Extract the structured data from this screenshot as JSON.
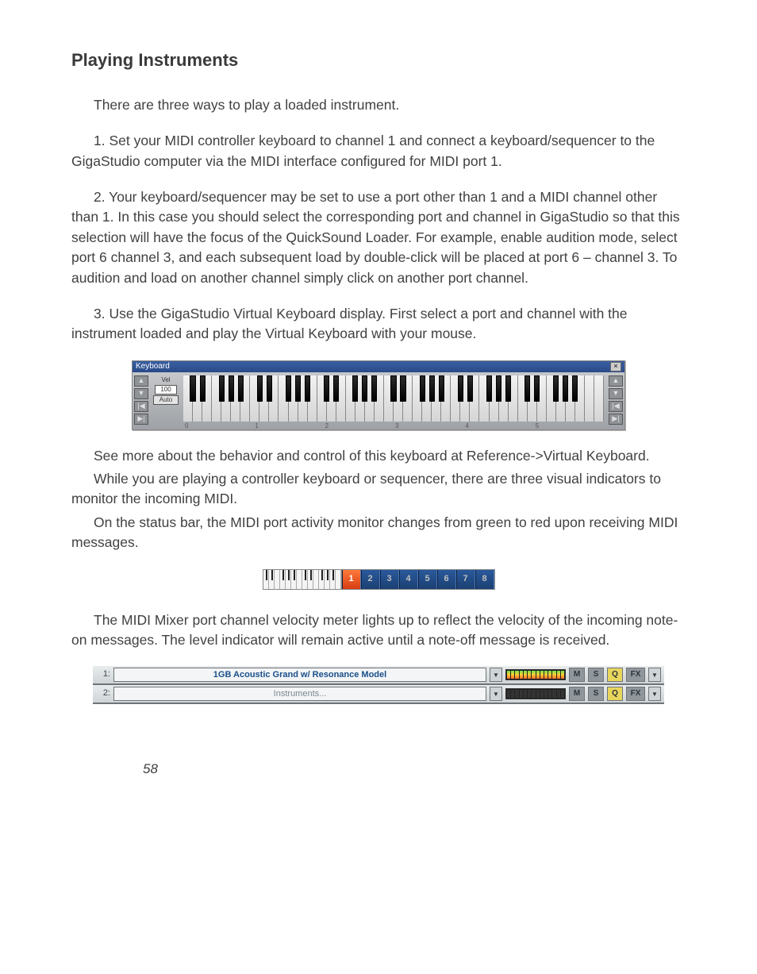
{
  "heading": "Playing Instruments",
  "p_intro": "There are three ways to play a loaded instrument.",
  "p_step1": "1. Set your MIDI controller keyboard to channel 1 and connect a keyboard/sequencer to the GigaStudio computer via the MIDI interface configured for MIDI port 1.",
  "p_step2": "2. Your keyboard/sequencer may be set to use a port other than 1 and a MIDI channel other than 1. In this case you should select the corresponding port and channel in GigaStudio so that this selection will have the focus of the QuickSound Loader. For example, enable audition mode, select port 6 channel 3, and each subsequent load by double-click will be placed at port 6 – channel 3. To audition and load on another channel simply click on another port channel.",
  "p_step3": "3. Use the GigaStudio Virtual Keyboard display. First select a port and channel with the instrument loaded and play the Virtual Keyboard with your mouse.",
  "p_after_kbd_1": "See more about the behavior and control of this keyboard at Reference->Virtual Keyboard.",
  "p_after_kbd_2": "While you are playing a controller keyboard or sequencer, there are three visual indicators to monitor the incoming MIDI.",
  "p_after_kbd_3": "On the status bar, the MIDI port activity monitor changes from green to red upon receiving MIDI messages.",
  "p_after_ports": "The MIDI Mixer port channel velocity meter lights up to reflect the velocity of the incoming note-on messages. The level indicator will remain active until a note-off message is received.",
  "kbd": {
    "title": "Keyboard",
    "close": "×",
    "vel_label": "Vel",
    "vel_value": "100",
    "auto_label": "Auto",
    "nav_up": "▲",
    "nav_down": "▼",
    "nav_first": "|◀",
    "nav_last": "▶|",
    "oct_labels": [
      "0",
      "1",
      "2",
      "3",
      "4",
      "5"
    ]
  },
  "ports": {
    "active_index": 0,
    "labels": [
      "1",
      "2",
      "3",
      "4",
      "5",
      "6",
      "7",
      "8"
    ]
  },
  "mixer": {
    "rows": [
      {
        "idx": "1:",
        "name": "1GB Acoustic Grand w/ Resonance Model",
        "lit": true,
        "dim": false
      },
      {
        "idx": "2:",
        "name": "Instruments...",
        "lit": false,
        "dim": true
      }
    ],
    "btn_m": "M",
    "btn_s": "S",
    "btn_q": "Q",
    "btn_fx": "FX",
    "dd": "▼"
  },
  "page_number": "58"
}
